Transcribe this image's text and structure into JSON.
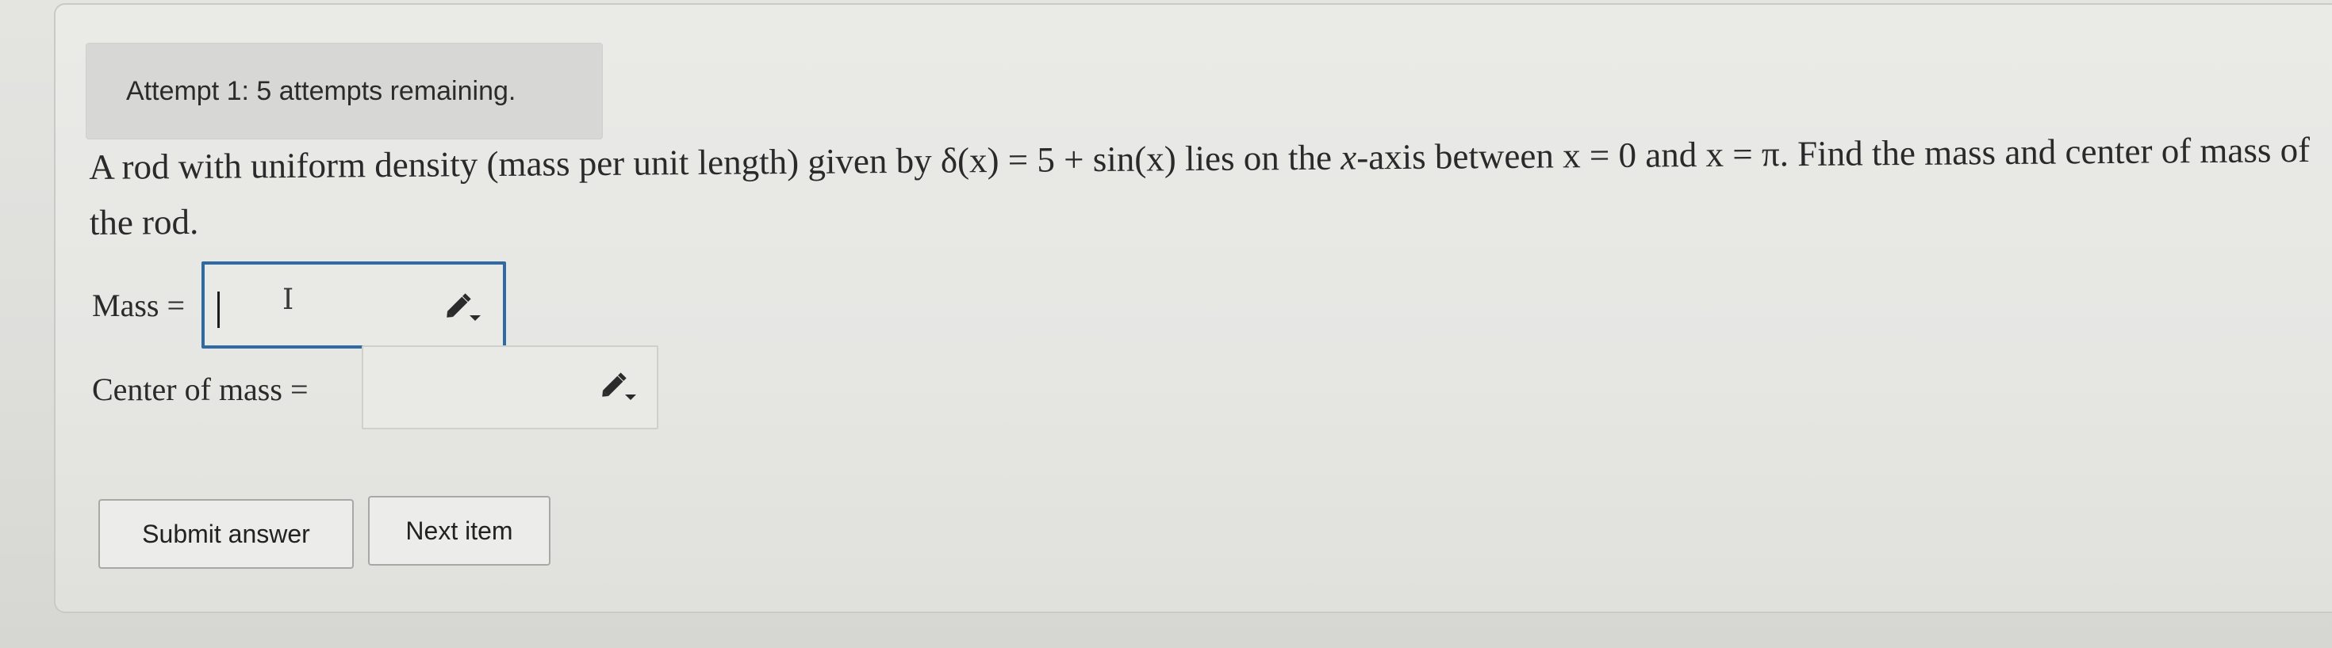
{
  "attempt": {
    "text": "Attempt 1: 5 attempts remaining."
  },
  "problem": {
    "text_before": "A rod with uniform density (mass per unit length) given by ",
    "density_expr": "δ(x) = 5 + sin(x)",
    "text_mid1": " lies on the ",
    "axis_var": "x",
    "text_mid2": "-axis between ",
    "bound_low": "x = 0",
    "text_and": " and ",
    "bound_high": "x = π",
    "text_after": ". Find the mass and center of mass of the rod."
  },
  "fields": {
    "mass": {
      "label": "Mass =",
      "value": ""
    },
    "center": {
      "label": "Center of mass =",
      "value": ""
    }
  },
  "buttons": {
    "submit": "Submit answer",
    "next": "Next item"
  },
  "icons": {
    "edit": "pencil-dropdown-icon",
    "cursor": "i-beam-cursor-icon"
  },
  "colors": {
    "focus_border": "#2f6aa3",
    "icon_color": "#2b2b2b"
  }
}
